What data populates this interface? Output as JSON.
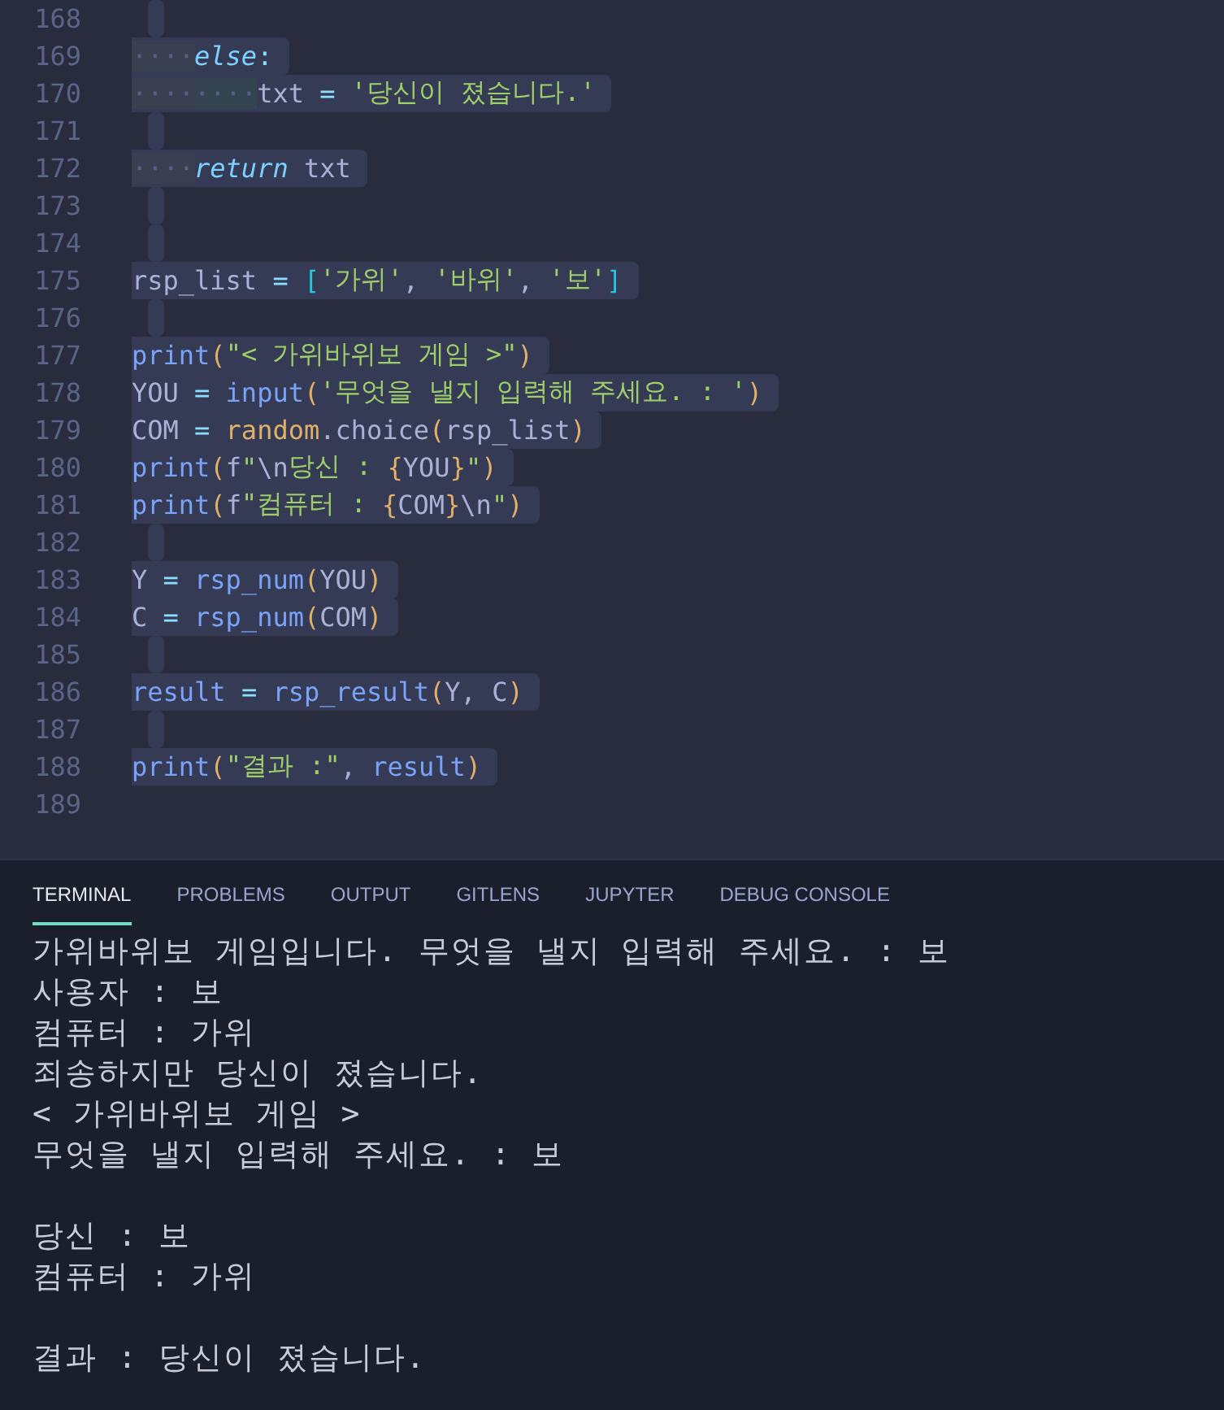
{
  "editor": {
    "lines": [
      {
        "number": "168",
        "selected": true
      },
      {
        "number": "169",
        "selected": true,
        "tokens": [
          {
            "kind": "indent",
            "text": "····"
          },
          {
            "kind": "keyword",
            "text": "else"
          },
          {
            "kind": "op",
            "text": ":"
          }
        ]
      },
      {
        "number": "170",
        "selected": true,
        "tokens": [
          {
            "kind": "indent",
            "text": "····"
          },
          {
            "kind": "indent2",
            "text": "····"
          },
          {
            "kind": "plain",
            "text": "txt "
          },
          {
            "kind": "op",
            "text": "= "
          },
          {
            "kind": "string",
            "text": "'당신이 졌습니다.'"
          }
        ]
      },
      {
        "number": "171",
        "selected": true
      },
      {
        "number": "172",
        "selected": true,
        "tokens": [
          {
            "kind": "indent",
            "text": "····"
          },
          {
            "kind": "keyword",
            "text": "return"
          },
          {
            "kind": "plain",
            "text": " txt"
          }
        ]
      },
      {
        "number": "173",
        "selected": true
      },
      {
        "number": "174",
        "selected": true
      },
      {
        "number": "175",
        "selected": true,
        "tokens": [
          {
            "kind": "plain",
            "text": "rsp_list "
          },
          {
            "kind": "op",
            "text": "= "
          },
          {
            "kind": "bracket",
            "text": "["
          },
          {
            "kind": "string",
            "text": "'가위'"
          },
          {
            "kind": "plain",
            "text": ", "
          },
          {
            "kind": "string",
            "text": "'바위'"
          },
          {
            "kind": "plain",
            "text": ", "
          },
          {
            "kind": "string",
            "text": "'보'"
          },
          {
            "kind": "bracket",
            "text": "]"
          }
        ]
      },
      {
        "number": "176",
        "selected": true
      },
      {
        "number": "177",
        "selected": true,
        "tokens": [
          {
            "kind": "func",
            "text": "print"
          },
          {
            "kind": "paren",
            "text": "("
          },
          {
            "kind": "string",
            "text": "\"< 가위바위보 게임 >\""
          },
          {
            "kind": "paren",
            "text": ")"
          }
        ]
      },
      {
        "number": "178",
        "selected": true,
        "tokens": [
          {
            "kind": "plain",
            "text": "YOU "
          },
          {
            "kind": "op",
            "text": "= "
          },
          {
            "kind": "func",
            "text": "input"
          },
          {
            "kind": "paren",
            "text": "("
          },
          {
            "kind": "string",
            "text": "'무엇을 낼지 입력해 주세요. : '"
          },
          {
            "kind": "paren",
            "text": ")"
          }
        ]
      },
      {
        "number": "179",
        "selected": true,
        "tokens": [
          {
            "kind": "plain",
            "text": "COM "
          },
          {
            "kind": "op",
            "text": "= "
          },
          {
            "kind": "module",
            "text": "random"
          },
          {
            "kind": "plain",
            "text": ".choice"
          },
          {
            "kind": "paren",
            "text": "("
          },
          {
            "kind": "plain",
            "text": "rsp_list"
          },
          {
            "kind": "paren",
            "text": ")"
          }
        ]
      },
      {
        "number": "180",
        "selected": true,
        "tokens": [
          {
            "kind": "func",
            "text": "print"
          },
          {
            "kind": "paren",
            "text": "("
          },
          {
            "kind": "plain",
            "text": "f"
          },
          {
            "kind": "string",
            "text": "\""
          },
          {
            "kind": "plain",
            "text": "\\n"
          },
          {
            "kind": "string",
            "text": "당신 : "
          },
          {
            "kind": "paren",
            "text": "{"
          },
          {
            "kind": "plain",
            "text": "YOU"
          },
          {
            "kind": "paren",
            "text": "}"
          },
          {
            "kind": "string",
            "text": "\""
          },
          {
            "kind": "paren",
            "text": ")"
          }
        ]
      },
      {
        "number": "181",
        "selected": true,
        "tokens": [
          {
            "kind": "func",
            "text": "print"
          },
          {
            "kind": "paren",
            "text": "("
          },
          {
            "kind": "plain",
            "text": "f"
          },
          {
            "kind": "string",
            "text": "\"컴퓨터 : "
          },
          {
            "kind": "paren",
            "text": "{"
          },
          {
            "kind": "plain",
            "text": "COM"
          },
          {
            "kind": "paren",
            "text": "}"
          },
          {
            "kind": "plain",
            "text": "\\n"
          },
          {
            "kind": "string",
            "text": "\""
          },
          {
            "kind": "paren",
            "text": ")"
          }
        ]
      },
      {
        "number": "182",
        "selected": true
      },
      {
        "number": "183",
        "selected": true,
        "tokens": [
          {
            "kind": "plain",
            "text": "Y "
          },
          {
            "kind": "op",
            "text": "= "
          },
          {
            "kind": "func",
            "text": "rsp_num"
          },
          {
            "kind": "paren",
            "text": "("
          },
          {
            "kind": "plain",
            "text": "YOU"
          },
          {
            "kind": "paren",
            "text": ")"
          }
        ]
      },
      {
        "number": "184",
        "selected": true,
        "tokens": [
          {
            "kind": "plain",
            "text": "C "
          },
          {
            "kind": "op",
            "text": "= "
          },
          {
            "kind": "func",
            "text": "rsp_num"
          },
          {
            "kind": "paren",
            "text": "("
          },
          {
            "kind": "plain",
            "text": "COM"
          },
          {
            "kind": "paren",
            "text": ")"
          }
        ]
      },
      {
        "number": "185",
        "selected": true
      },
      {
        "number": "186",
        "selected": true,
        "tokens": [
          {
            "kind": "func",
            "text": "result "
          },
          {
            "kind": "op",
            "text": "= "
          },
          {
            "kind": "func",
            "text": "rsp_result"
          },
          {
            "kind": "paren",
            "text": "("
          },
          {
            "kind": "plain",
            "text": "Y, C"
          },
          {
            "kind": "paren",
            "text": ")"
          }
        ]
      },
      {
        "number": "187",
        "selected": true
      },
      {
        "number": "188",
        "selected": true,
        "tokens": [
          {
            "kind": "func",
            "text": "print"
          },
          {
            "kind": "paren",
            "text": "("
          },
          {
            "kind": "string",
            "text": "\"결과 :\""
          },
          {
            "kind": "plain",
            "text": ", "
          },
          {
            "kind": "func",
            "text": "result"
          },
          {
            "kind": "paren",
            "text": ")"
          }
        ]
      },
      {
        "number": "189",
        "selected": false
      }
    ]
  },
  "panel": {
    "tabs": [
      {
        "label": "TERMINAL",
        "selected": true
      },
      {
        "label": "PROBLEMS",
        "selected": false
      },
      {
        "label": "OUTPUT",
        "selected": false
      },
      {
        "label": "GITLENS",
        "selected": false
      },
      {
        "label": "JUPYTER",
        "selected": false
      },
      {
        "label": "DEBUG CONSOLE",
        "selected": false
      }
    ],
    "terminal_blocks": [
      {
        "lines": [
          "가위바위보 게임입니다. 무엇을 낼지 입력해 주세요. : 보",
          "사용자 : 보",
          "컴퓨터 : 가위",
          "죄송하지만 당신이 졌습니다.",
          "< 가위바위보 게임 >",
          "무엇을 낼지 입력해 주세요. : 보"
        ]
      },
      {
        "lines": [
          "당신 : 보",
          "컴퓨터 : 가위"
        ]
      },
      {
        "lines": [
          "결과 : 당신이 졌습니다."
        ]
      }
    ]
  }
}
